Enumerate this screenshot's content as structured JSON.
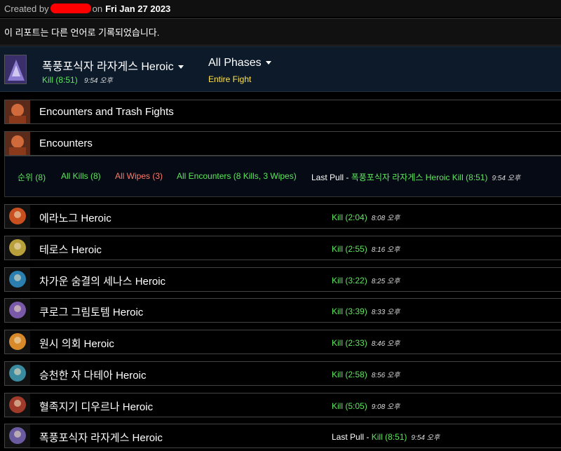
{
  "created": {
    "prefix": "Created by",
    "middle": "on",
    "date": "Fri Jan 27 2023"
  },
  "language_notice": "이 리포트는 다른 언어로 기록되었습니다.",
  "header": {
    "boss_title": "폭풍포식자 라자게스 Heroic",
    "kill_label": "Kill (8:51)",
    "kill_time": "9:54 오후",
    "phase_title": "All Phases",
    "phase_sub": "Entire Fight"
  },
  "sections": {
    "encounters_and_trash": "Encounters and Trash Fights",
    "encounters": "Encounters"
  },
  "filters": {
    "rank": "순위 (8)",
    "all_kills": "All Kills (8)",
    "all_wipes": "All Wipes (3)",
    "all_encounters": "All Encounters (8 Kills, 3 Wipes)",
    "last_pull_label": "Last Pull",
    "last_pull_sep": " - ",
    "last_pull_value": "폭풍포식자 라자게스 Heroic Kill (8:51)",
    "last_pull_time": "9:54 오후"
  },
  "encounters": [
    {
      "name": "에라노그 Heroic",
      "result": "Kill (2:04)",
      "time": "8:08 오후",
      "color": "#c8501e"
    },
    {
      "name": "테로스 Heroic",
      "result": "Kill (2:55)",
      "time": "8:16 오후",
      "color": "#b8a03a"
    },
    {
      "name": "차가운 숨결의 세나스 Heroic",
      "result": "Kill (3:22)",
      "time": "8:25 오후",
      "color": "#2a7fb0"
    },
    {
      "name": "쿠로그 그림토템 Heroic",
      "result": "Kill (3:39)",
      "time": "8:33 오후",
      "color": "#7a5aa8"
    },
    {
      "name": "원시 의회 Heroic",
      "result": "Kill (2:33)",
      "time": "8:46 오후",
      "color": "#d88a2a"
    },
    {
      "name": "승천한 자 다테아 Heroic",
      "result": "Kill (2:58)",
      "time": "8:56 오후",
      "color": "#3a8aa0"
    },
    {
      "name": "혈족지기 디우르나 Heroic",
      "result": "Kill (5:05)",
      "time": "9:08 오후",
      "color": "#a03a2a"
    },
    {
      "name": "폭풍포식자 라자게스 Heroic",
      "result": "Kill (8:51)",
      "time": "9:54 오후",
      "last_pull_label": "Last Pull",
      "color": "#6a5aa0"
    }
  ]
}
